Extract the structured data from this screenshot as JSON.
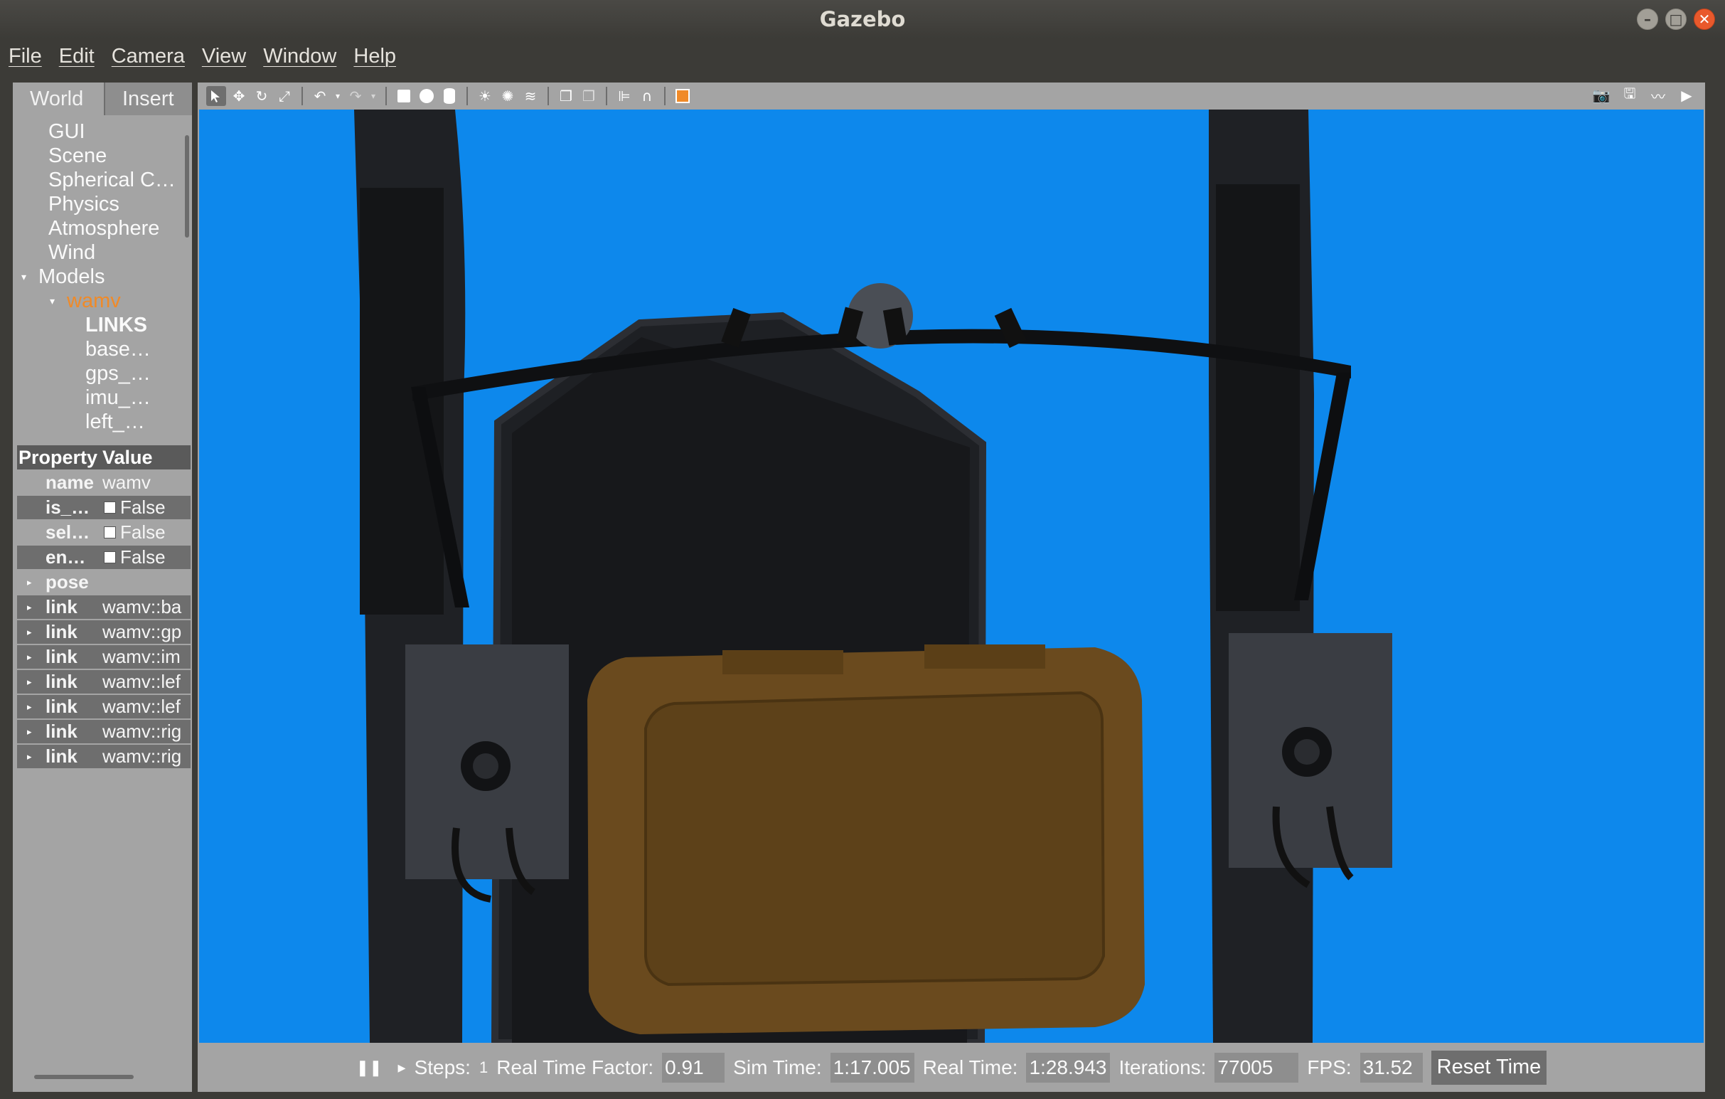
{
  "window": {
    "title": "Gazebo",
    "buttons": [
      "–",
      "□",
      "✕"
    ]
  },
  "menu": [
    "File",
    "Edit",
    "Camera",
    "View",
    "Window",
    "Help"
  ],
  "left_panel": {
    "tabs": [
      "World",
      "Insert"
    ],
    "tree": [
      {
        "label": "GUI",
        "indent": 1
      },
      {
        "label": "Scene",
        "indent": 1
      },
      {
        "label": "Spherical C…",
        "indent": 1
      },
      {
        "label": "Physics",
        "indent": 1
      },
      {
        "label": "Atmosphere",
        "indent": 1
      },
      {
        "label": "Wind",
        "indent": 1
      },
      {
        "label": "Models",
        "indent": 0,
        "expanded": true
      },
      {
        "label": "wamv",
        "indent": 2,
        "expanded": true,
        "selected": true
      },
      {
        "label": "LINKS",
        "indent": 3,
        "bold": true
      },
      {
        "label": "base…",
        "indent": 3
      },
      {
        "label": "gps_…",
        "indent": 3
      },
      {
        "label": "imu_…",
        "indent": 3
      },
      {
        "label": "left_…",
        "indent": 3
      }
    ],
    "properties_header": {
      "property": "Property",
      "value": "Value"
    },
    "properties": [
      {
        "key": "name",
        "value": "wamv",
        "checkbox": false,
        "expandable": false
      },
      {
        "key": "is_…",
        "value": "False",
        "checkbox": true,
        "expandable": false
      },
      {
        "key": "sel…",
        "value": "False",
        "checkbox": true,
        "expandable": false
      },
      {
        "key": "en…",
        "value": "False",
        "checkbox": true,
        "expandable": false
      },
      {
        "key": "pose",
        "value": "",
        "checkbox": false,
        "expandable": true
      },
      {
        "key": "link",
        "value": "wamv::ba",
        "checkbox": false,
        "expandable": true
      },
      {
        "key": "link",
        "value": "wamv::gp",
        "checkbox": false,
        "expandable": true
      },
      {
        "key": "link",
        "value": "wamv::im",
        "checkbox": false,
        "expandable": true
      },
      {
        "key": "link",
        "value": "wamv::lef",
        "checkbox": false,
        "expandable": true
      },
      {
        "key": "link",
        "value": "wamv::lef",
        "checkbox": false,
        "expandable": true
      },
      {
        "key": "link",
        "value": "wamv::rig",
        "checkbox": false,
        "expandable": true
      },
      {
        "key": "link",
        "value": "wamv::rig",
        "checkbox": false,
        "expandable": true
      }
    ]
  },
  "toolbar": {
    "tools": [
      "select-tool",
      "translate-tool",
      "rotate-tool",
      "scale-tool",
      "undo",
      "undo-dropdown",
      "redo",
      "redo-dropdown",
      "box-shape",
      "sphere-shape",
      "cylinder-shape",
      "point-light",
      "spot-light",
      "directional-light",
      "copy",
      "paste",
      "align",
      "snap",
      "change-view"
    ],
    "right_tools": [
      "screenshot",
      "log",
      "plot",
      "record-video"
    ]
  },
  "status": {
    "steps_label": "Steps:",
    "steps_value": "1",
    "rtf_label": "Real Time Factor:",
    "rtf_value": "0.91",
    "sim_label": "Sim Time:",
    "sim_value": "1:17.005",
    "real_label": "Real Time:",
    "real_value": "1:28.943",
    "iter_label": "Iterations:",
    "iter_value": "77005",
    "fps_label": "FPS:",
    "fps_value": "31.52",
    "reset_label": "Reset Time"
  },
  "colors": {
    "sky": "#0d88ec",
    "panel": "#a4a4a4",
    "selected_model": "#f08a28",
    "chrome": "#3c3b37"
  }
}
